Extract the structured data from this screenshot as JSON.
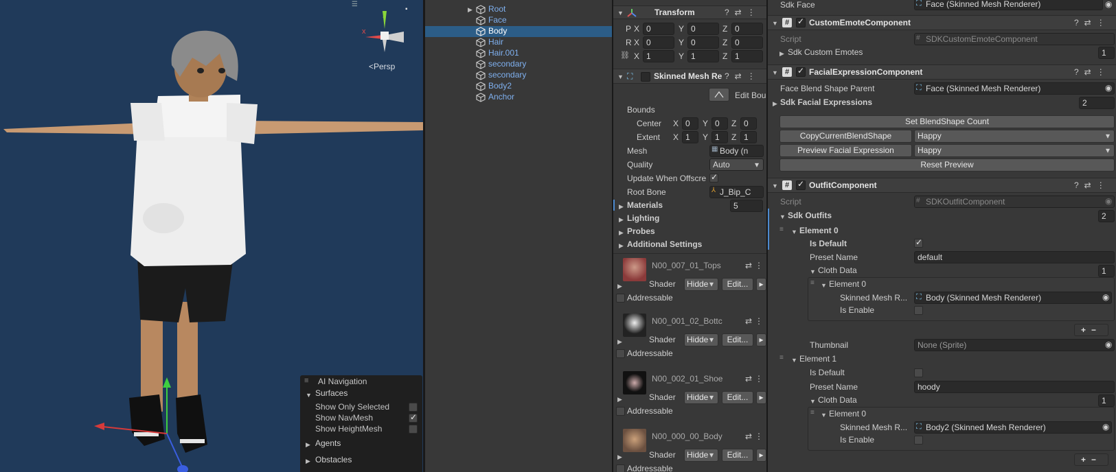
{
  "scene": {
    "gizmo": {
      "y_label": "y",
      "x_label": "x",
      "persp_label": "<Persp"
    },
    "nav_panel": {
      "title": "AI Navigation",
      "surfaces": "Surfaces",
      "options": [
        {
          "label": "Show Only Selected",
          "checked": false
        },
        {
          "label": "Show NavMesh",
          "checked": true
        },
        {
          "label": "Show HeightMesh",
          "checked": false
        }
      ],
      "agents": "Agents",
      "obstacles": "Obstacles"
    }
  },
  "hierarchy": {
    "items": [
      {
        "label": "Root",
        "selected": false,
        "arrow": true
      },
      {
        "label": "Face",
        "selected": false,
        "arrow": false
      },
      {
        "label": "Body",
        "selected": true,
        "arrow": false
      },
      {
        "label": "Hair",
        "selected": false,
        "arrow": false
      },
      {
        "label": "Hair.001",
        "selected": false,
        "arrow": false
      },
      {
        "label": "secondary",
        "selected": false,
        "arrow": false
      },
      {
        "label": "secondary",
        "selected": false,
        "arrow": false
      },
      {
        "label": "Body2",
        "selected": false,
        "arrow": false
      },
      {
        "label": "Anchor",
        "selected": false,
        "arrow": false
      }
    ]
  },
  "inspectorA": {
    "transform": {
      "title": "Transform",
      "rows": [
        {
          "label": "P",
          "x": "0",
          "y": "0",
          "z": "0"
        },
        {
          "label": "R",
          "x": "0",
          "y": "0",
          "z": "0"
        },
        {
          "label": "",
          "x": "1",
          "y": "1",
          "z": "1"
        }
      ],
      "axis": {
        "x": "X",
        "y": "Y",
        "z": "Z"
      }
    },
    "smr": {
      "title": "Skinned Mesh Re",
      "edit_bounds": "Edit Bou",
      "bounds": "Bounds",
      "center": {
        "label": "Center",
        "x": "0",
        "y": "0",
        "z": "0"
      },
      "extent": {
        "label": "Extent",
        "x": "1",
        "y": "1",
        "z": "1"
      },
      "mesh_label": "Mesh",
      "mesh_value": "Body (n",
      "quality_label": "Quality",
      "quality_value": "Auto",
      "update_label": "Update When Offscre",
      "root_label": "Root Bone",
      "root_value": "J_Bip_C",
      "materials_label": "Materials",
      "materials_count": "5",
      "lighting": "Lighting",
      "probes": "Probes",
      "additional": "Additional Settings"
    },
    "materials": [
      {
        "name": "N00_007_01_Tops",
        "shader": "Shader",
        "shader_value": "Hidde",
        "edit": "Edit...",
        "addressable": "Addressable",
        "color": "#8b3a3a"
      },
      {
        "name": "N00_001_02_Bottc",
        "shader": "Shader",
        "shader_value": "Hidde",
        "edit": "Edit...",
        "addressable": "Addressable",
        "color": "#2a2a2a"
      },
      {
        "name": "N00_002_01_Shoe",
        "shader": "Shader",
        "shader_value": "Hidde",
        "edit": "Edit...",
        "addressable": "Addressable",
        "color": "#111111"
      },
      {
        "name": "N00_000_00_Body",
        "shader": "Shader",
        "shader_value": "Hidde",
        "edit": "Edit...",
        "addressable": "Addressable",
        "color": "#a87a5a"
      }
    ]
  },
  "inspectorB": {
    "sdk_face_label": "Sdk Face",
    "sdk_face_value": "Face (Skinned Mesh Renderer)",
    "emote": {
      "title": "CustomEmoteComponent",
      "script_label": "Script",
      "script_value": "SDKCustomEmoteComponent",
      "emotes_label": "Sdk Custom Emotes",
      "emotes_count": "1"
    },
    "facial": {
      "title": "FacialExpressionComponent",
      "parent_label": "Face Blend Shape Parent",
      "parent_value": "Face (Skinned Mesh Renderer)",
      "expr_label": "Sdk Facial Expressions",
      "expr_count": "2",
      "set_count": "Set BlendShape Count",
      "copy_btn": "CopyCurrentBlendShape",
      "copy_value": "Happy",
      "preview_btn": "Preview Facial Expression",
      "preview_value": "Happy",
      "reset": "Reset Preview"
    },
    "outfit": {
      "title": "OutfitComponent",
      "script_label": "Script",
      "script_value": "SDKOutfitComponent",
      "outfits_label": "Sdk Outfits",
      "outfits_count": "2",
      "elements": [
        {
          "label": "Element 0",
          "is_default_label": "Is Default",
          "is_default": true,
          "preset_label": "Preset Name",
          "preset_value": "default",
          "cloth_label": "Cloth Data",
          "cloth_count": "1",
          "cloth_element": "Element 0",
          "smr_label": "Skinned Mesh R...",
          "smr_value": "Body (Skinned Mesh Renderer)",
          "enable_label": "Is Enable",
          "thumb_label": "Thumbnail",
          "thumb_value": "None (Sprite)"
        },
        {
          "label": "Element 1",
          "is_default_label": "Is Default",
          "is_default": false,
          "preset_label": "Preset Name",
          "preset_value": "hoody",
          "cloth_label": "Cloth Data",
          "cloth_count": "1",
          "cloth_element": "Element 0",
          "smr_label": "Skinned Mesh R...",
          "smr_value": "Body2 (Skinned Mesh Renderer)",
          "enable_label": "Is Enable"
        }
      ]
    }
  }
}
